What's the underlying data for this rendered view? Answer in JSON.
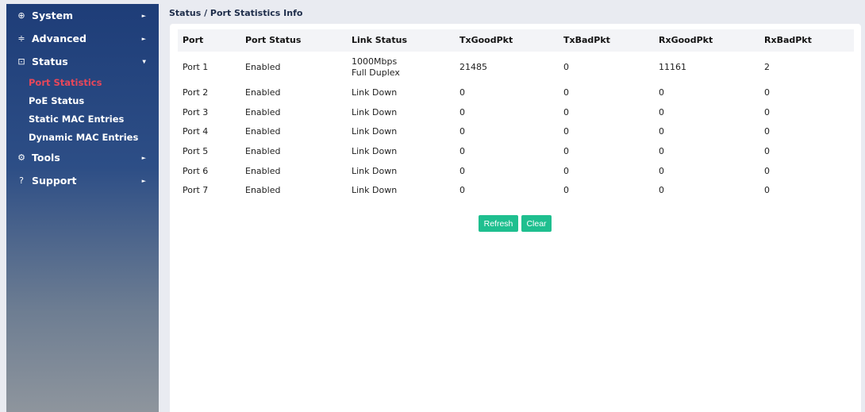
{
  "sidebar": {
    "system": {
      "label": "System",
      "icon": "globe-icon"
    },
    "advanced": {
      "label": "Advanced",
      "icon": "sliders-icon"
    },
    "status": {
      "label": "Status",
      "icon": "monitor-icon",
      "items": [
        "Port Statistics",
        "PoE Status",
        "Static MAC Entries",
        "Dynamic MAC Entries"
      ],
      "active": "Port Statistics"
    },
    "tools": {
      "label": "Tools",
      "icon": "gear-icon"
    },
    "support": {
      "label": "Support",
      "icon": "help-icon"
    }
  },
  "breadcrumb": "Status / Port Statistics Info",
  "table": {
    "headers": [
      "Port",
      "Port Status",
      "Link Status",
      "TxGoodPkt",
      "TxBadPkt",
      "RxGoodPkt",
      "RxBadPkt"
    ],
    "rows": [
      [
        "Port 1",
        "Enabled",
        "1000Mbps Full Duplex",
        "21485",
        "0",
        "11161",
        "2"
      ],
      [
        "Port 2",
        "Enabled",
        "Link Down",
        "0",
        "0",
        "0",
        "0"
      ],
      [
        "Port 3",
        "Enabled",
        "Link Down",
        "0",
        "0",
        "0",
        "0"
      ],
      [
        "Port 4",
        "Enabled",
        "Link Down",
        "0",
        "0",
        "0",
        "0"
      ],
      [
        "Port 5",
        "Enabled",
        "Link Down",
        "0",
        "0",
        "0",
        "0"
      ],
      [
        "Port 6",
        "Enabled",
        "Link Down",
        "0",
        "0",
        "0",
        "0"
      ],
      [
        "Port 7",
        "Enabled",
        "Link Down",
        "0",
        "0",
        "0",
        "0"
      ]
    ],
    "port1_link_lines": [
      "1000Mbps",
      "Full Duplex"
    ]
  },
  "buttons": {
    "refresh": "Refresh",
    "clear": "Clear"
  },
  "colors": {
    "accent": "#1fbf8f",
    "active_nav": "#e8475a",
    "sidebar": "#1e3d78"
  }
}
